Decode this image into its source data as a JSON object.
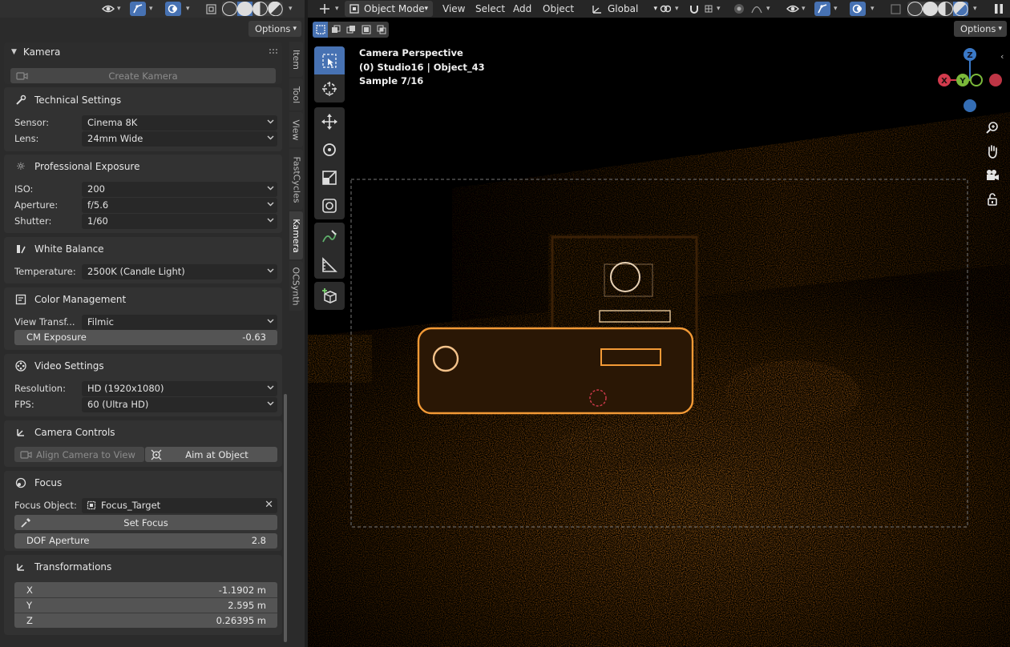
{
  "colors": {
    "accent": "#4772b3",
    "selection_outline": "#f39a36",
    "axis_x": "#d33b4d",
    "axis_y": "#7bb93a",
    "axis_z": "#3a79c8"
  },
  "left_header": {
    "options_label": "Options"
  },
  "viewport_header": {
    "mode_label": "Object Mode",
    "menus": [
      "View",
      "Select",
      "Add",
      "Object"
    ],
    "orientation_label": "Global",
    "options_label": "Options"
  },
  "sidebar_tabs": [
    "Item",
    "Tool",
    "View",
    "FastCycles",
    "Kamera",
    "OCSynth"
  ],
  "active_tab": "Kamera",
  "panels": {
    "kamera": {
      "title": "Kamera",
      "create_button": "Create Kamera"
    },
    "technical": {
      "title": "Technical Settings",
      "sensor_label": "Sensor:",
      "sensor_value": "Cinema 8K",
      "lens_label": "Lens:",
      "lens_value": "24mm Wide"
    },
    "exposure": {
      "title": "Professional Exposure",
      "iso_label": "ISO:",
      "iso_value": "200",
      "aperture_label": "Aperture:",
      "aperture_value": "f/5.6",
      "shutter_label": "Shutter:",
      "shutter_value": "1/60"
    },
    "white_balance": {
      "title": "White Balance",
      "temp_label": "Temperature:",
      "temp_value": "2500K (Candle Light)"
    },
    "color_mgmt": {
      "title": "Color Management",
      "view_label": "View Transf...",
      "view_value": "Filmic",
      "cm_exposure_label": "CM Exposure",
      "cm_exposure_value": "-0.63"
    },
    "video": {
      "title": "Video Settings",
      "res_label": "Resolution:",
      "res_value": "HD (1920x1080)",
      "fps_label": "FPS:",
      "fps_value": "60 (Ultra HD)"
    },
    "camera_controls": {
      "title": "Camera Controls",
      "align_button": "Align Camera to View",
      "aim_button": "Aim at Object"
    },
    "focus": {
      "title": "Focus",
      "object_label": "Focus Object:",
      "object_value": "Focus_Target",
      "set_focus_button": "Set Focus",
      "dof_label": "DOF Aperture",
      "dof_value": "2.8"
    },
    "transform": {
      "title": "Transformations",
      "x_label": "X",
      "x_value": "-1.1902 m",
      "y_label": "Y",
      "y_value": "2.595 m",
      "z_label": "Z",
      "z_value": "0.26395 m"
    }
  },
  "viewport_overlay": {
    "line1": "Camera Perspective",
    "line2": "(0) Studio16 | Object_43",
    "line3": "Sample 7/16"
  },
  "gizmo": {
    "x": "X",
    "y": "Y",
    "z": "Z"
  }
}
